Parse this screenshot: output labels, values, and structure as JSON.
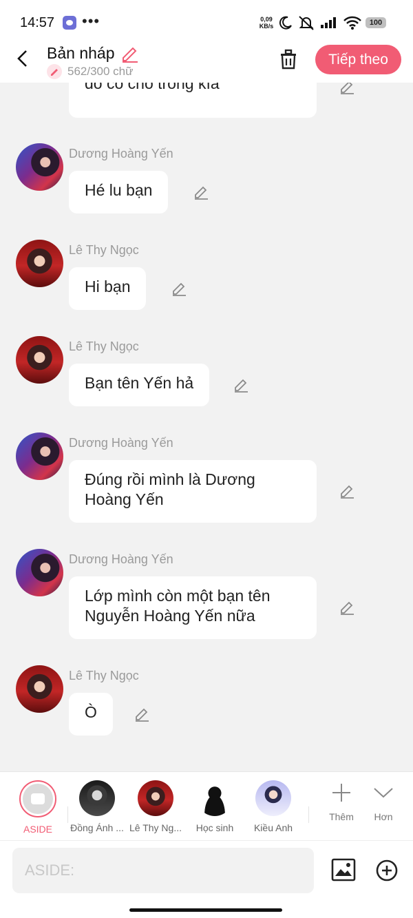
{
  "status_bar": {
    "time": "14:57",
    "more": "•••",
    "net_speed_value": "0,09",
    "net_speed_unit": "KB/s",
    "battery": "100",
    "icons": [
      "messenger-icon",
      "moon-icon",
      "silent-icon",
      "signal-icon",
      "wifi-icon",
      "battery-icon"
    ]
  },
  "header": {
    "title": "Bản nháp",
    "word_count": "562/300 chữ",
    "next_label": "Tiếp theo",
    "accent_color": "#f15c74"
  },
  "chat": {
    "top_partial_text": "đó có chỗ trống kìa",
    "messages": [
      {
        "sender": "Dương Hoàng Yến",
        "line1": "Hé lu bạn",
        "line2": ""
      },
      {
        "sender": "Lê Thy Ngọc",
        "line1": "Hi bạn",
        "line2": ""
      },
      {
        "sender": "Lê Thy Ngọc",
        "line1": "Bạn tên Yến hả",
        "line2": ""
      },
      {
        "sender": "Dương Hoàng Yến",
        "line1": "Đúng rồi mình là Dương",
        "line2": "Hoàng Yến"
      },
      {
        "sender": "Dương Hoàng Yến",
        "line1": "Lớp mình còn một bạn tên",
        "line2": "Nguyễn Hoàng Yến nữa"
      },
      {
        "sender": "Lê Thy Ngọc",
        "line1": "Ò",
        "line2": ""
      }
    ]
  },
  "characters": [
    {
      "label": "ASIDE"
    },
    {
      "label": "Đồng Ánh ..."
    },
    {
      "label": "Lê Thy Ng..."
    },
    {
      "label": "Học sinh"
    },
    {
      "label": "Kiều Anh"
    }
  ],
  "more_actions": {
    "add_label": "Thêm",
    "expand_label": "Hơn"
  },
  "input": {
    "placeholder": "ASIDE:"
  }
}
